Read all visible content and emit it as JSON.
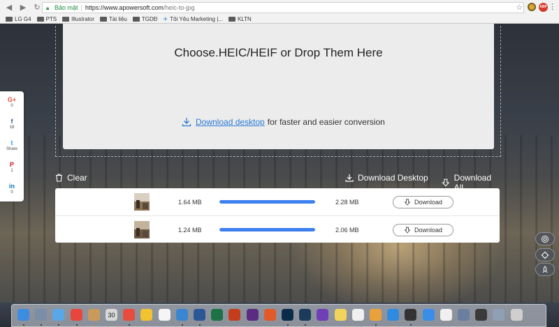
{
  "browser": {
    "security_label": "Bảo mật",
    "url_host": "https://www.apowersoft.com",
    "url_path": "/heic-to-jpg",
    "bookmarks": [
      "LG G4",
      "PTS",
      "Illustrator",
      "Tài liệu",
      "TGDĐ",
      "Tôi Yêu Marketing |...",
      "KLTN"
    ]
  },
  "dropzone": {
    "title": "Choose.HEIC/HEIF or Drop Them Here",
    "download_link": "Download desktop",
    "download_suffix": "for faster and easier conversion"
  },
  "toolbar": {
    "clear": "Clear",
    "download_desktop": "Download Desktop",
    "download_all": "Download All"
  },
  "files": [
    {
      "original_size": "1.64 MB",
      "converted_size": "2.28 MB",
      "progress": 1.0,
      "button": "Download"
    },
    {
      "original_size": "1.24 MB",
      "converted_size": "2.06 MB",
      "progress": 1.0,
      "button": "Download"
    }
  ],
  "share": [
    {
      "icon": "G+",
      "count": "0",
      "color": "#dd4b39"
    },
    {
      "icon": "f",
      "count": "18",
      "color": "#3b5998"
    },
    {
      "icon": "t",
      "count": "Share",
      "color": "#1da1f2"
    },
    {
      "icon": "P",
      "count": "1",
      "color": "#cb2027"
    },
    {
      "icon": "in",
      "count": "0",
      "color": "#0077b5"
    }
  ],
  "colors": {
    "accent": "#3e7ff0",
    "link": "#2a7ad8",
    "secure": "#1e8e3e"
  },
  "dock": {
    "calendar_day": "30"
  }
}
